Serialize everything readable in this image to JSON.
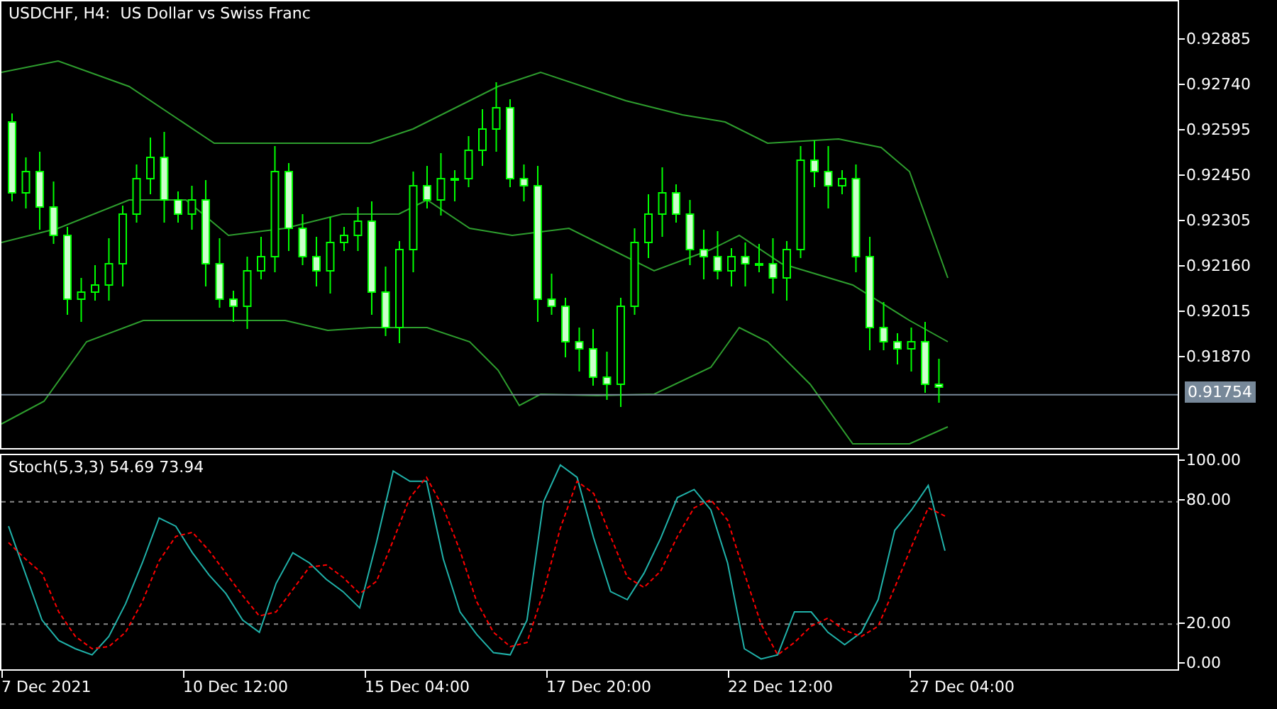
{
  "chart_title": "USDCHF, H4:  US Dollar vs Swiss Franc",
  "price_axis": {
    "ticks": [
      "0.92885",
      "0.92740",
      "0.92595",
      "0.92450",
      "0.92305",
      "0.92160",
      "0.92015",
      "0.91870"
    ],
    "current_price": "0.91754"
  },
  "stochastic": {
    "label": "Stoch(5,3,3) 54.69 73.94",
    "chart_data": {
      "type": "line",
      "ylim": [
        -2.8,
        103.5
      ],
      "yticks": [
        {
          "value": 0,
          "label": "0.00"
        },
        {
          "value": 20,
          "label": "20.00"
        },
        {
          "value": 80,
          "label": "80.00"
        },
        {
          "value": 100,
          "label": "100.00"
        }
      ],
      "series": [
        {
          "color": "#20b2aa",
          "line_style": "solid",
          "values": [
            68,
            45,
            22,
            12,
            8,
            5,
            14,
            30,
            50,
            72,
            68,
            55,
            44,
            35,
            22,
            16,
            40,
            55,
            50,
            42,
            36,
            28,
            60,
            95,
            90,
            90,
            52,
            26,
            15,
            6,
            5,
            22,
            80,
            98,
            92,
            62,
            36,
            32,
            45,
            62,
            82,
            86,
            76,
            50,
            8,
            3,
            5,
            26,
            26,
            16,
            10,
            16,
            32,
            66,
            76,
            88,
            56
          ]
        },
        {
          "color": "#ff0000",
          "line_style": "dashed",
          "values": [
            60,
            52,
            45,
            26,
            14,
            8,
            9,
            16,
            31,
            51,
            63,
            65,
            56,
            45,
            34,
            24,
            26,
            37,
            48,
            49,
            43,
            35,
            41,
            61,
            82,
            92,
            77,
            56,
            31,
            16,
            9,
            11,
            36,
            67,
            90,
            84,
            63,
            43,
            38,
            46,
            63,
            77,
            81,
            71,
            45,
            20,
            5,
            11,
            19,
            23,
            17,
            14,
            19,
            38,
            58,
            77,
            73
          ]
        }
      ]
    }
  },
  "time_axis": [
    "7 Dec 2021",
    "10 Dec 12:00",
    "15 Dec 04:00",
    "17 Dec 20:00",
    "22 Dec 12:00",
    "27 Dec 04:00"
  ]
}
